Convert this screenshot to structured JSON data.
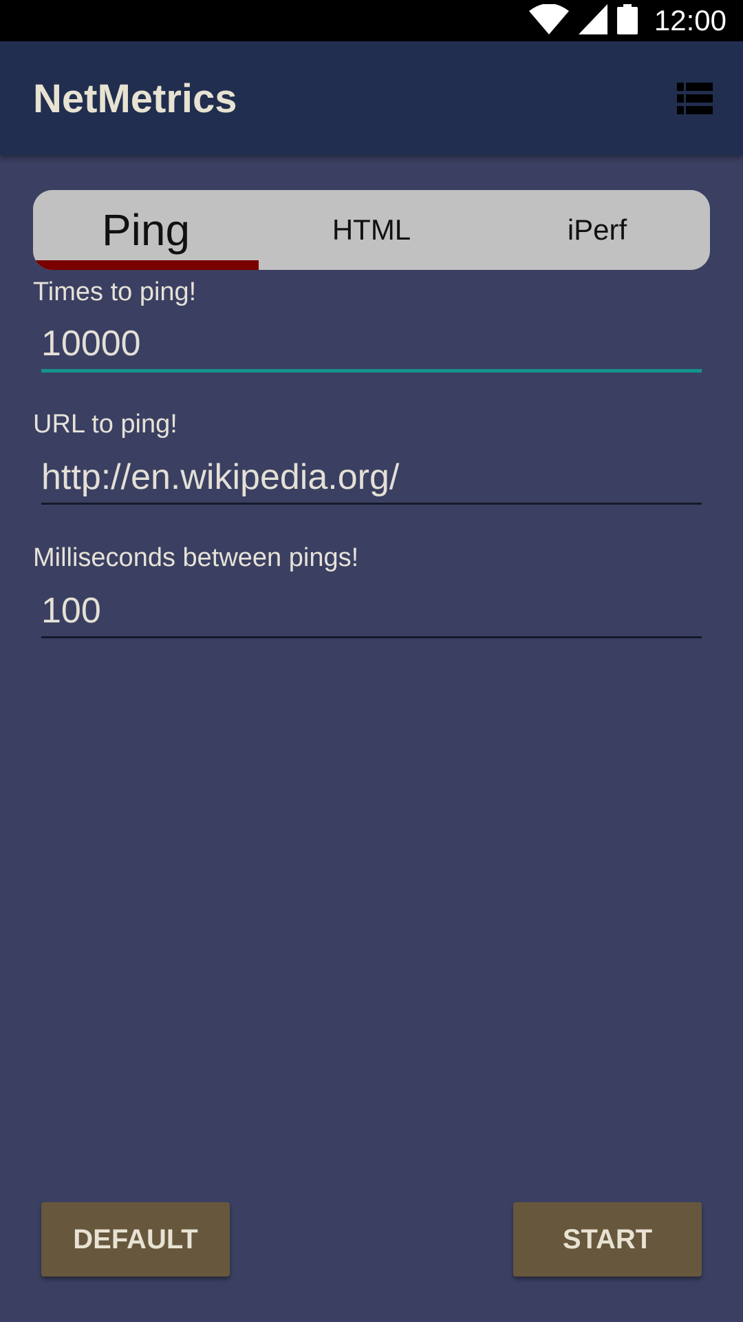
{
  "status_bar": {
    "time": "12:00",
    "icons": [
      "wifi-icon",
      "signal-icon",
      "battery-icon"
    ]
  },
  "app_bar": {
    "title": "NetMetrics",
    "action_icon": "list-icon"
  },
  "tabs": [
    {
      "label": "Ping",
      "active": true
    },
    {
      "label": "HTML",
      "active": false
    },
    {
      "label": "iPerf",
      "active": false
    }
  ],
  "form": {
    "times_to_ping": {
      "label": "Times to ping!",
      "value": "10000",
      "focused": true
    },
    "url_to_ping": {
      "label": "URL to ping!",
      "value": "http://en.wikipedia.org/"
    },
    "ms_between_pings": {
      "label": "Milliseconds between pings!",
      "value": "100"
    }
  },
  "buttons": {
    "default_label": "DEFAULT",
    "start_label": "START"
  },
  "colors": {
    "background": "#3b4062",
    "app_bar": "#212e4f",
    "tab_background": "#c1c1c1",
    "tab_indicator": "#7a0000",
    "focus_underline": "#13958a",
    "button": "#67573d",
    "text_light": "#e8e2d2"
  }
}
